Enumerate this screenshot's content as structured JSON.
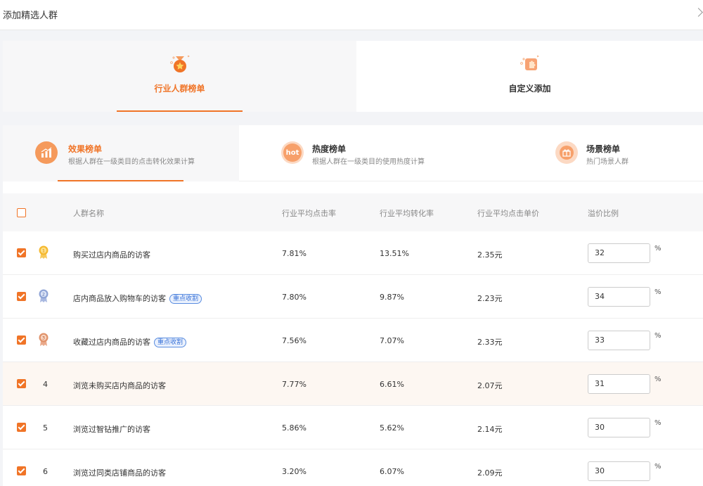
{
  "header": {
    "title": "添加精选人群"
  },
  "category_tabs": [
    {
      "label": "行业人群榜单",
      "active": true,
      "icon": "medal-icon"
    },
    {
      "label": "自定义添加",
      "active": false,
      "icon": "puzzle-icon"
    }
  ],
  "rank_tabs": [
    {
      "title": "效果榜单",
      "subtitle": "根据人群在一级类目的点击转化效果计算",
      "icon": "bar-chart-icon",
      "active": true
    },
    {
      "title": "热度榜单",
      "subtitle": "根据人群在一级类目的使用热度计算",
      "icon": "hot-icon",
      "icon_text": "hot",
      "active": false
    },
    {
      "title": "场景榜单",
      "subtitle": "热门场景人群",
      "icon": "gift-icon",
      "active": false
    }
  ],
  "table": {
    "columns": {
      "name": "人群名称",
      "ctr": "行业平均点击率",
      "cvr": "行业平均转化率",
      "cpc": "行业平均点击单价",
      "ratio": "溢价比例"
    },
    "rows": [
      {
        "rank": "1",
        "medal": "gold",
        "name": "购买过店内商品的访客",
        "tag": "",
        "ctr": "7.81%",
        "cvr": "13.51%",
        "cpc": "2.35元",
        "ratio": "32",
        "unit": "%",
        "checked": true
      },
      {
        "rank": "2",
        "medal": "silver",
        "name": "店内商品放入购物车的访客",
        "tag": "重点收割",
        "ctr": "7.80%",
        "cvr": "9.87%",
        "cpc": "2.23元",
        "ratio": "34",
        "unit": "%",
        "checked": true
      },
      {
        "rank": "3",
        "medal": "bronze",
        "name": "收藏过店内商品的访客",
        "tag": "重点收割",
        "ctr": "7.56%",
        "cvr": "7.07%",
        "cpc": "2.33元",
        "ratio": "33",
        "unit": "%",
        "checked": true
      },
      {
        "rank": "4",
        "medal": "",
        "name": "浏览未购买店内商品的访客",
        "tag": "",
        "ctr": "7.77%",
        "cvr": "6.61%",
        "cpc": "2.07元",
        "ratio": "31",
        "unit": "%",
        "checked": true
      },
      {
        "rank": "5",
        "medal": "",
        "name": "浏览过智钻推广的访客",
        "tag": "",
        "ctr": "5.86%",
        "cvr": "5.62%",
        "cpc": "2.14元",
        "ratio": "30",
        "unit": "%",
        "checked": true
      },
      {
        "rank": "6",
        "medal": "",
        "name": "浏览过同类店铺商品的访客",
        "tag": "",
        "ctr": "3.20%",
        "cvr": "6.07%",
        "cpc": "2.09元",
        "ratio": "30",
        "unit": "%",
        "checked": true
      }
    ]
  },
  "colors": {
    "accent": "#f07427",
    "tag_blue": "#3a73d8",
    "gold": "#f5b82e",
    "silver": "#8fa4d6",
    "bronze": "#e0926a"
  }
}
